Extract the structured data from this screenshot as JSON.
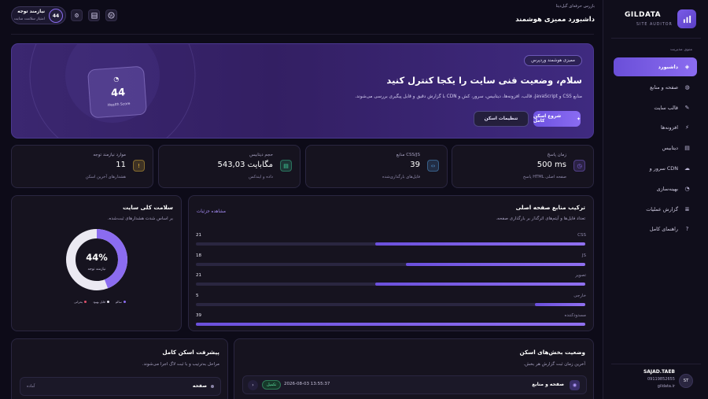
{
  "brand": {
    "name": "GILDATA",
    "subtitle": "SITE AUDITOR"
  },
  "sidebar": {
    "section_label": "منوی مدیریت",
    "items": [
      {
        "label": "داشبورد",
        "icon": "dashboard-icon",
        "active": true
      },
      {
        "label": "صفحه و منابع",
        "icon": "globe-icon"
      },
      {
        "label": "قالب سایت",
        "icon": "brush-icon"
      },
      {
        "label": "افزونه‌ها",
        "icon": "plug-icon"
      },
      {
        "label": "دیتابیس",
        "icon": "database-icon"
      },
      {
        "label": "سرور و CDN",
        "icon": "cloud-icon"
      },
      {
        "label": "بهینه‌سازی",
        "icon": "gauge-icon"
      },
      {
        "label": "گزارش عملیات",
        "icon": "list-icon"
      },
      {
        "label": "راهنمای کامل",
        "icon": "help-icon"
      }
    ],
    "user": {
      "name": "SAJAD.TAEB",
      "phone": "09119852655",
      "site": "gildata.ir",
      "initials": "ST"
    }
  },
  "header": {
    "breadcrumb": "بازرس حرفه‌ای گیل‌دیتا",
    "title": "داشبورد ممیزی هوشمند",
    "alert_title": "نیازمند توجه",
    "alert_sub": "امتیاز سلامت سایت",
    "alert_score": "44"
  },
  "hero": {
    "badge": "ممیزی هوشمند وردپرس",
    "title": "سلام، وضعیت فنی سایت را یکجا کنترل کنید",
    "desc": "منابع CSS و JavaScript، قالب، افزونه‌ها، دیتابیس، سرور، کش و CDN با گزارش دقیق و قابل پیگیری بررسی می‌شوند.",
    "primary_btn": "شروع اسکن کامل",
    "secondary_btn": "تنظیمات اسکن",
    "health_score": "44",
    "health_label": "Health Score"
  },
  "stats": [
    {
      "label": "زمان پاسخ",
      "value": "500 ms",
      "sub": "پاسخ HTML صفحه اصلی",
      "icon": "clock-icon",
      "color": "#8b6cf0"
    },
    {
      "label": "منابع CSS/JS",
      "value": "39",
      "sub": "فایل‌های بارگذاری‌شده",
      "icon": "code-icon",
      "color": "#5aa9f0"
    },
    {
      "label": "حجم دیتابیس",
      "value": "543,03 مگابایت",
      "sub": "داده و ایندکس",
      "icon": "database-icon",
      "color": "#3fd09a"
    },
    {
      "label": "موارد نیازمند توجه",
      "value": "11",
      "sub": "هشدارهای آخرین اسکن",
      "icon": "warning-icon",
      "color": "#f2c23e"
    }
  ],
  "resources": {
    "title": "ترکیب منابع صفحه اصلی",
    "subtitle": "تعداد فایل‌ها و آیتم‌های اثرگذار بر بارگذاری صفحه.",
    "link": "مشاهده جزئیات",
    "rows": [
      {
        "label": "CSS",
        "value": "21",
        "fraction": 0.54
      },
      {
        "label": "JS",
        "value": "18",
        "fraction": 0.46
      },
      {
        "label": "تصویر",
        "value": "21",
        "fraction": 0.54
      },
      {
        "label": "خارجی",
        "value": "5",
        "fraction": 0.13
      },
      {
        "label": "مسدودکننده",
        "value": "39",
        "fraction": 1.0
      }
    ]
  },
  "health": {
    "title": "سلامت کلی سایت",
    "subtitle": "بر اساس شدت هشدارهای ثبت‌شده.",
    "percent": "44%",
    "percent_value": 44,
    "status": "نیازمند توجه",
    "legend": [
      {
        "label": "سالم",
        "color": "#8b6cf0"
      },
      {
        "label": "قابل بهبود",
        "color": "#e8e6f2"
      },
      {
        "label": "بحرانی",
        "color": "#e0506a"
      }
    ]
  },
  "scan_status": {
    "title": "وضعیت بخش‌های اسکن",
    "subtitle": "آخرین زمان ثبت گزارش هر بخش.",
    "row": {
      "label": "صفحه و منابع",
      "time": "2026-08-03 13:55:37",
      "badge": "تکمیل"
    }
  },
  "progress": {
    "title": "پیشرفت اسکن کامل",
    "subtitle": "مراحل به‌ترتیب و با ثبت لاگ اجرا می‌شوند.",
    "row": {
      "label": "صفحه",
      "status": "آماده"
    }
  }
}
